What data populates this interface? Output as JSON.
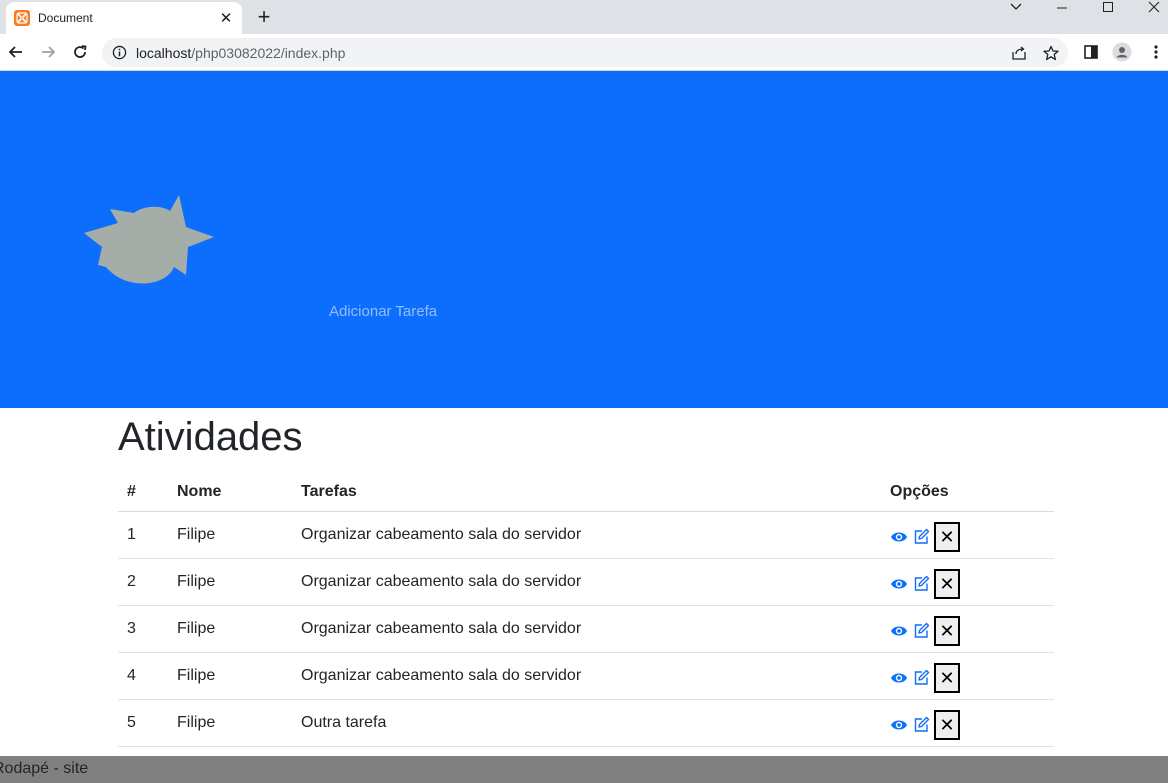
{
  "browser": {
    "tab_title": "Document",
    "tab_close": "✕",
    "new_tab": "+",
    "url_host": "localhost",
    "url_path": "/php03082022/index.php"
  },
  "hero": {
    "link_text": "Adicionar Tarefa",
    "background": "#0d6efd"
  },
  "main": {
    "title": "Atividades",
    "columns": [
      "#",
      "Nome",
      "Tarefas",
      "Opções"
    ],
    "rows": [
      {
        "id": "1",
        "nome": "Filipe",
        "tarefa": "Organizar cabeamento sala do servidor"
      },
      {
        "id": "2",
        "nome": "Filipe",
        "tarefa": "Organizar cabeamento sala do servidor"
      },
      {
        "id": "3",
        "nome": "Filipe",
        "tarefa": "Organizar cabeamento sala do servidor"
      },
      {
        "id": "4",
        "nome": "Filipe",
        "tarefa": "Organizar cabeamento sala do servidor"
      },
      {
        "id": "5",
        "nome": "Filipe",
        "tarefa": "Outra tarefa"
      }
    ],
    "option_icons": [
      "eye-icon",
      "edit-icon",
      "close-icon"
    ],
    "delete_label": "✕"
  },
  "footer": {
    "text": "Rodapé - site"
  },
  "colors": {
    "accent": "#0d6efd",
    "icon_blue": "#0d6efd",
    "footer_bg": "#808080"
  }
}
